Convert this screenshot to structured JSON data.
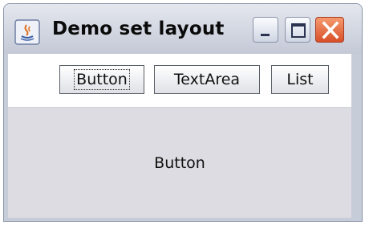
{
  "window": {
    "title": "Demo set layout",
    "icon": "java-cup-icon",
    "controls": [
      "minimize-icon",
      "maximize-icon",
      "close-icon"
    ]
  },
  "toolbar": {
    "buttons": [
      {
        "label": "Button",
        "focused": true
      },
      {
        "label": "TextArea",
        "focused": false
      },
      {
        "label": "List",
        "focused": false
      }
    ]
  },
  "center": {
    "label": "Button"
  },
  "colors": {
    "content_background": "#dcdce2",
    "close_button": "#d94f28"
  }
}
